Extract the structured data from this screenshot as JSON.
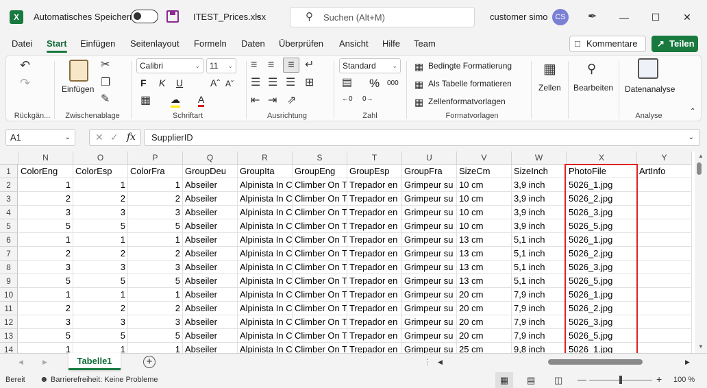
{
  "titlebar": {
    "autosave_label": "Automatisches Speichern",
    "filename": "ITEST_Prices.xlsx",
    "search_placeholder": "Suchen (Alt+M)",
    "user_name": "customer simo",
    "user_initials": "CS"
  },
  "menu": {
    "tabs": [
      "Datei",
      "Start",
      "Einfügen",
      "Seitenlayout",
      "Formeln",
      "Daten",
      "Überprüfen",
      "Ansicht",
      "Hilfe",
      "Team"
    ],
    "comments_label": "Kommentare",
    "share_label": "Teilen"
  },
  "ribbon": {
    "groups": {
      "undo": "Rückgän...",
      "clipboard": "Zwischenablage",
      "font": "Schriftart",
      "alignment": "Ausrichtung",
      "number": "Zahl",
      "styles": "Formatvorlagen",
      "analysis": "Analyse"
    },
    "paste_label": "Einfügen",
    "font_name": "Calibri",
    "font_size": "11",
    "number_format": "Standard",
    "percent_symbol": "%",
    "thousands_symbol": "000",
    "conditional_formatting": "Bedingte Formatierung",
    "format_as_table": "Als Tabelle formatieren",
    "cell_styles": "Zellenformatvorlagen",
    "cells_label": "Zellen",
    "editing_label": "Bearbeiten",
    "data_analysis_label": "Datenanalyse"
  },
  "formula_bar": {
    "name_box": "A1",
    "fx_label": "fx",
    "content": "SupplierID"
  },
  "grid": {
    "columns": [
      "N",
      "O",
      "P",
      "Q",
      "R",
      "S",
      "T",
      "U",
      "V",
      "W",
      "X",
      "Y"
    ],
    "row_numbers": [
      "1",
      "2",
      "3",
      "4",
      "5",
      "6",
      "7",
      "8",
      "9",
      "10",
      "11",
      "12",
      "13",
      "14"
    ],
    "header_row": [
      "ColorEng",
      "ColorEsp",
      "ColorFra",
      "GroupDeu",
      "GroupIta",
      "GroupEng",
      "GroupEsp",
      "GroupFra",
      "SizeCm",
      "SizeInch",
      "PhotoFile",
      "ArtInfo"
    ],
    "rows": [
      [
        "1",
        "1",
        "1",
        "Abseiler",
        "Alpinista In C",
        "Climber On T",
        "Trepador en",
        "Grimpeur su",
        "10 cm",
        "3,9 inch",
        "5026_1.jpg",
        ""
      ],
      [
        "2",
        "2",
        "2",
        "Abseiler",
        "Alpinista In C",
        "Climber On T",
        "Trepador en",
        "Grimpeur su",
        "10 cm",
        "3,9 inch",
        "5026_2.jpg",
        ""
      ],
      [
        "3",
        "3",
        "3",
        "Abseiler",
        "Alpinista In C",
        "Climber On T",
        "Trepador en",
        "Grimpeur su",
        "10 cm",
        "3,9 inch",
        "5026_3.jpg",
        ""
      ],
      [
        "5",
        "5",
        "5",
        "Abseiler",
        "Alpinista In C",
        "Climber On T",
        "Trepador en",
        "Grimpeur su",
        "10 cm",
        "3,9 inch",
        "5026_5.jpg",
        ""
      ],
      [
        "1",
        "1",
        "1",
        "Abseiler",
        "Alpinista In C",
        "Climber On T",
        "Trepador en",
        "Grimpeur su",
        "13 cm",
        "5,1 inch",
        "5026_1.jpg",
        ""
      ],
      [
        "2",
        "2",
        "2",
        "Abseiler",
        "Alpinista In C",
        "Climber On T",
        "Trepador en",
        "Grimpeur su",
        "13 cm",
        "5,1 inch",
        "5026_2.jpg",
        ""
      ],
      [
        "3",
        "3",
        "3",
        "Abseiler",
        "Alpinista In C",
        "Climber On T",
        "Trepador en",
        "Grimpeur su",
        "13 cm",
        "5,1 inch",
        "5026_3.jpg",
        ""
      ],
      [
        "5",
        "5",
        "5",
        "Abseiler",
        "Alpinista In C",
        "Climber On T",
        "Trepador en",
        "Grimpeur su",
        "13 cm",
        "5,1 inch",
        "5026_5.jpg",
        ""
      ],
      [
        "1",
        "1",
        "1",
        "Abseiler",
        "Alpinista In C",
        "Climber On T",
        "Trepador en",
        "Grimpeur su",
        "20 cm",
        "7,9 inch",
        "5026_1.jpg",
        ""
      ],
      [
        "2",
        "2",
        "2",
        "Abseiler",
        "Alpinista In C",
        "Climber On T",
        "Trepador en",
        "Grimpeur su",
        "20 cm",
        "7,9 inch",
        "5026_2.jpg",
        ""
      ],
      [
        "3",
        "3",
        "3",
        "Abseiler",
        "Alpinista In C",
        "Climber On T",
        "Trepador en",
        "Grimpeur su",
        "20 cm",
        "7,9 inch",
        "5026_3.jpg",
        ""
      ],
      [
        "5",
        "5",
        "5",
        "Abseiler",
        "Alpinista In C",
        "Climber On T",
        "Trepador en",
        "Grimpeur su",
        "20 cm",
        "7,9 inch",
        "5026_5.jpg",
        ""
      ],
      [
        "1",
        "1",
        "1",
        "Abseiler",
        "Alpinista In C",
        "Climber On T",
        "Trepador en",
        "Grimpeur su",
        "25 cm",
        "9,8 inch",
        "5026_1.jpg",
        ""
      ]
    ]
  },
  "sheets": {
    "active_tab": "Tabelle1"
  },
  "status": {
    "ready": "Bereit",
    "accessibility": "Barrierefreiheit: Keine Probleme",
    "zoom": "100 %"
  },
  "colors": {
    "excel_green": "#187a3f",
    "highlight_red": "#e02020",
    "avatar": "#7a7fd6"
  }
}
